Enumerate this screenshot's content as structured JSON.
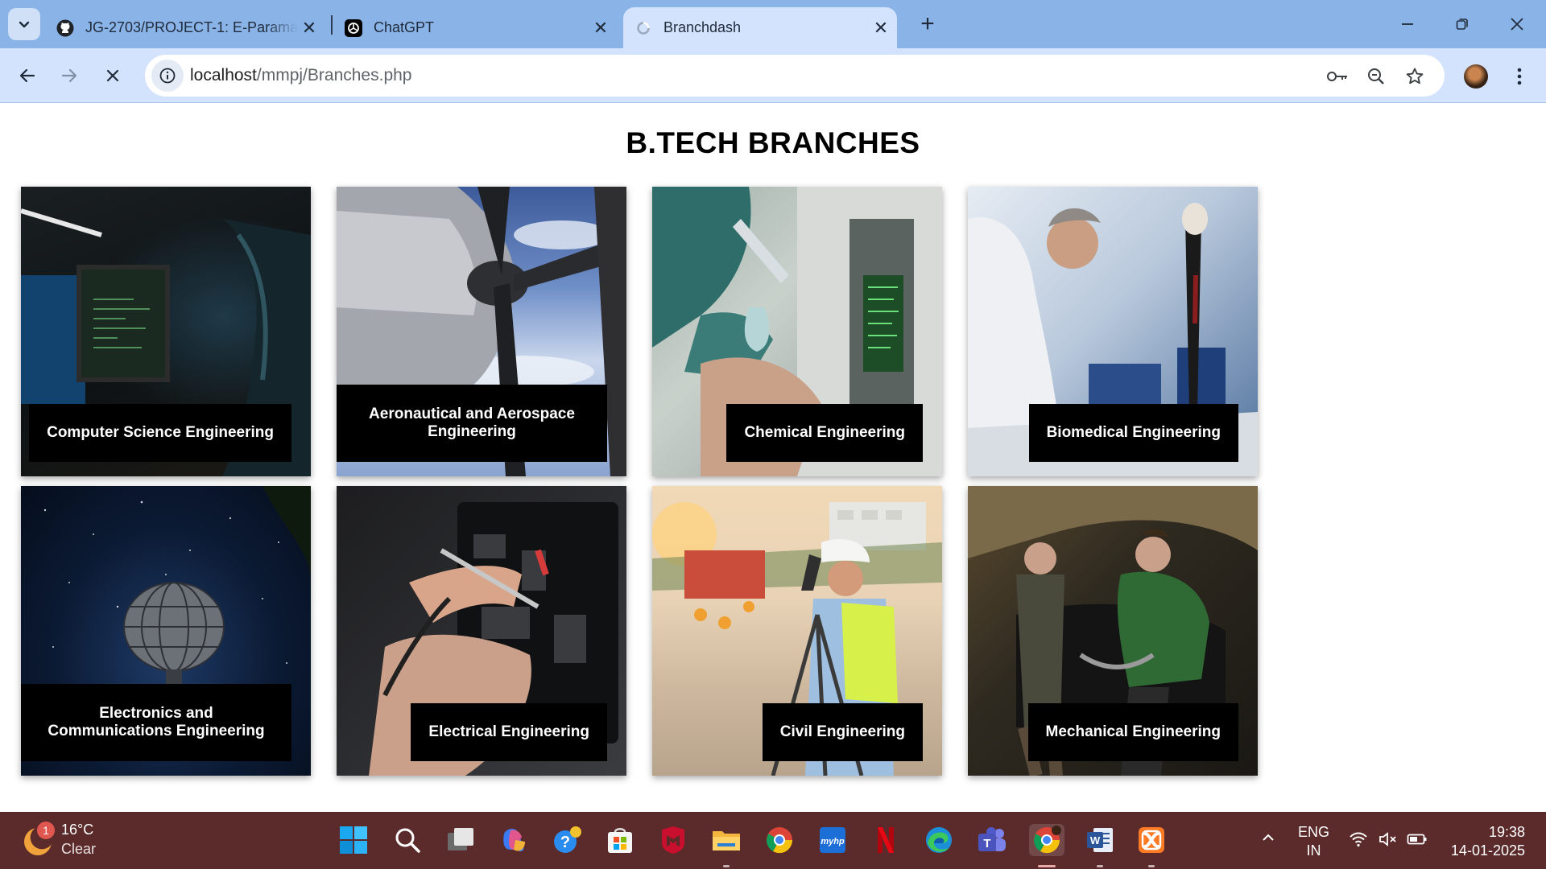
{
  "tabs": [
    {
      "title": "JG-2703/PROJECT-1: E-Paramanam",
      "icon": "github-icon"
    },
    {
      "title": "ChatGPT",
      "icon": "chatgpt-icon"
    },
    {
      "title": "Branchdash",
      "icon": "loading-icon"
    }
  ],
  "address": {
    "host": "localhost",
    "path": "/mmpj/Branches.php"
  },
  "page": {
    "heading": "B.TECH BRANCHES",
    "branches": [
      {
        "name": "Computer Science Engineering"
      },
      {
        "name": "Aeronautical and Aerospace Engineering"
      },
      {
        "name": "Chemical Engineering"
      },
      {
        "name": "Biomedical Engineering"
      },
      {
        "name": "Electronics and Communications Engineering"
      },
      {
        "name": "Electrical Engineering"
      },
      {
        "name": "Civil Engineering"
      },
      {
        "name": "Mechanical Engineering"
      }
    ]
  },
  "taskbar": {
    "weather": {
      "temp": "16°C",
      "desc": "Clear",
      "badge": "1"
    },
    "lang": {
      "line1": "ENG",
      "line2": "IN"
    },
    "clock": {
      "time": "19:38",
      "date": "14-01-2025"
    }
  },
  "colors": {
    "tabstrip": "#8ab4e8",
    "toolbar": "#d3e3fd",
    "taskbar": "#5b2a2a",
    "label_bg": "#000000"
  }
}
